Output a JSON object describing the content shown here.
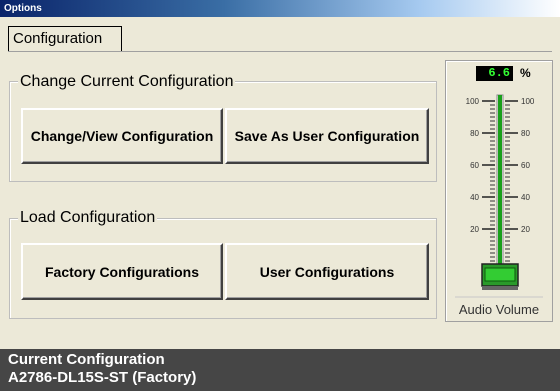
{
  "window": {
    "title": "Options"
  },
  "tabs": [
    {
      "label": "Configuration"
    }
  ],
  "change_group": {
    "title": "Change Current Configuration",
    "change_view_label": "Change/View Configuration",
    "save_as_user_label": "Save As User Configuration"
  },
  "load_group": {
    "title": "Load Configuration",
    "factory_label": "Factory Configurations",
    "user_label": "User Configurations"
  },
  "audio_volume": {
    "value": "6.6",
    "unit": "%",
    "label": "Audio Volume",
    "ticks": [
      "100",
      "80",
      "60",
      "40",
      "20"
    ],
    "level_fraction": 0.066,
    "colors": {
      "fill": "#1aa01a",
      "readout": "#33ff33"
    }
  },
  "status": {
    "heading": "Current Configuration",
    "value": "A2786-DL15S-ST (Factory)"
  }
}
